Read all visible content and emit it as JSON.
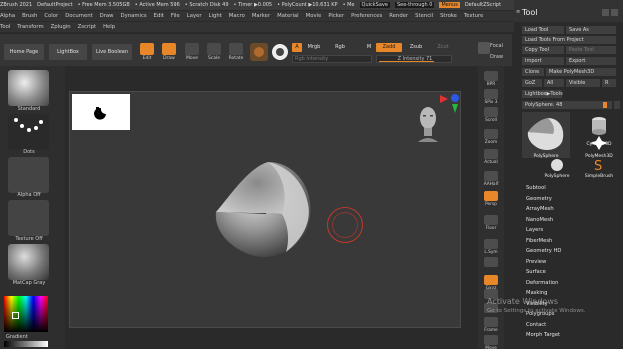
{
  "titlebar": {
    "app": "ZBrush 2021",
    "project": "DefaultProject",
    "free_mem": "• Free Mem 3.505GB",
    "active_mem": "• Active Mem 596",
    "scratch": "• Scratch Disk 49",
    "timer": "• Timer ▶0.005",
    "polycount": "• PolyCount ▶10.631 KP",
    "mesh": "• Me",
    "quicksave": "QuickSave",
    "seethrough": "See-through  0",
    "menus": "Menus",
    "script": "DefaultZScript"
  },
  "menus_row1": [
    "Alpha",
    "Brush",
    "Color",
    "Document",
    "Draw",
    "Dynamics",
    "Edit",
    "File",
    "Layer",
    "Light",
    "Macro",
    "Marker",
    "Material",
    "Movie",
    "Picker",
    "Preferences",
    "Render",
    "Stencil",
    "Stroke",
    "Texture"
  ],
  "menus_row2": [
    "Tool",
    "Transform",
    "Zplugin",
    "Zscript",
    "Help"
  ],
  "toolbar": {
    "home_page": "Home Page",
    "lightbox": "LightBox",
    "live_boolean": "Live Boolean",
    "edit": "Edit",
    "draw": "Draw",
    "move": "Move",
    "scale": "Scale",
    "rotate": "Rotate",
    "a_label": "A",
    "mrgb": "Mrgb",
    "rgb": "Rgb",
    "m": "M",
    "zadd": "Zadd",
    "zsub": "Zsub",
    "zcut": "Zcut",
    "rgb_intensity": "Rgb Intensity",
    "z_intensity": "Z Intensity 71",
    "focal_shift": "Focal",
    "draw_size": "Draw"
  },
  "left_shelf": {
    "standard": "Standard",
    "dots": "Dots",
    "alpha_off": "Alpha Off",
    "texture_off": "Texture Off",
    "matcap": "MatCap Gray",
    "gradient": "Gradient"
  },
  "right_column": [
    "BPR",
    "SPix 3",
    "Scroll",
    "Zoom",
    "Actual",
    "AAHalf",
    "Persp",
    "Floor",
    "L.Sym",
    "",
    "Gxyz",
    "",
    "",
    "Frame",
    "Move"
  ],
  "tool_panel": {
    "title": "Tool",
    "load_tool": "Load Tool",
    "save_as": "Save As",
    "load_from_project": "Load Tools From Project",
    "copy_tool": "Copy Tool",
    "paste_tool": "Paste Tool",
    "import": "Import",
    "export": "Export",
    "clone": "Clone",
    "make_polymesh": "Make PolyMesh3D",
    "goz": "GoZ",
    "all": "All",
    "visible": "Visible",
    "r": "R",
    "lightbox_tools": "Lightbox▶Tools",
    "polysphere_slider": "PolySphere. 48",
    "thumbs": [
      "PolySphere",
      "Cylinder3D",
      "PolySphere",
      "PolyMesh3D",
      "PolySphere",
      "SimpleBrush"
    ],
    "subpalettes": [
      "Subtool",
      "Geometry",
      "ArrayMesh",
      "NanoMesh",
      "Layers",
      "FiberMesh",
      "Geometry HD",
      "Preview",
      "Surface",
      "Deformation",
      "Masking",
      "Visibility",
      "Polygroups",
      "Contact",
      "Morph Target"
    ]
  },
  "watermark": {
    "line1": "Activate Windows",
    "line2": "Go to Settings to activate Windows."
  },
  "colors": {
    "accent": "#e8862a",
    "panel": "#2a2a2a",
    "canvas": "#393939"
  }
}
